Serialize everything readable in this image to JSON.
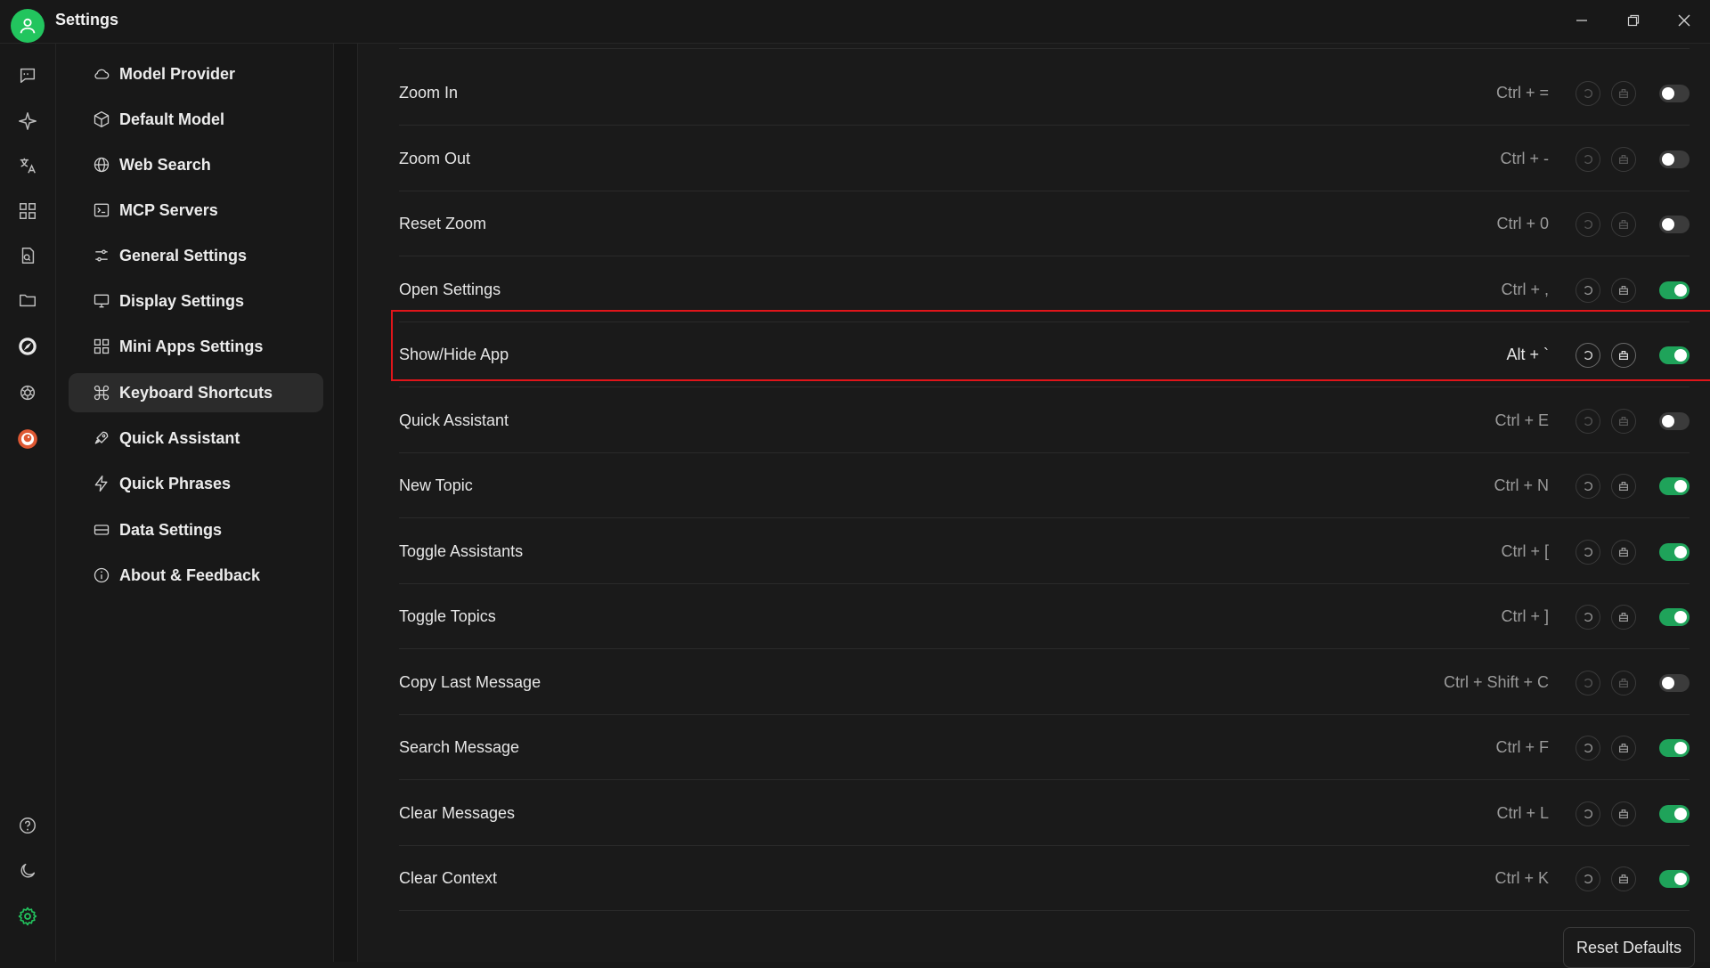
{
  "window": {
    "title": "Settings"
  },
  "nav": {
    "items": [
      {
        "label": "Model Provider",
        "icon": "cloud-icon"
      },
      {
        "label": "Default Model",
        "icon": "cube-icon"
      },
      {
        "label": "Web Search",
        "icon": "globe-icon"
      },
      {
        "label": "MCP Servers",
        "icon": "terminal-icon"
      },
      {
        "label": "General Settings",
        "icon": "sliders-icon"
      },
      {
        "label": "Display Settings",
        "icon": "monitor-icon"
      },
      {
        "label": "Mini Apps Settings",
        "icon": "grid-icon"
      },
      {
        "label": "Keyboard Shortcuts",
        "icon": "command-icon",
        "active": true
      },
      {
        "label": "Quick Assistant",
        "icon": "rocket-icon"
      },
      {
        "label": "Quick Phrases",
        "icon": "zap-icon"
      },
      {
        "label": "Data Settings",
        "icon": "database-icon"
      },
      {
        "label": "About & Feedback",
        "icon": "info-icon"
      }
    ]
  },
  "shortcuts": [
    {
      "label": "Zoom In",
      "keys": "Ctrl + =",
      "enabled": false
    },
    {
      "label": "Zoom Out",
      "keys": "Ctrl + -",
      "enabled": false
    },
    {
      "label": "Reset Zoom",
      "keys": "Ctrl + 0",
      "enabled": false
    },
    {
      "label": "Open Settings",
      "keys": "Ctrl + ,",
      "enabled": true
    },
    {
      "label": "Show/Hide App",
      "keys": "Alt + `",
      "enabled": true,
      "highlighted": true
    },
    {
      "label": "Quick Assistant",
      "keys": "Ctrl + E",
      "enabled": false
    },
    {
      "label": "New Topic",
      "keys": "Ctrl + N",
      "enabled": true
    },
    {
      "label": "Toggle Assistants",
      "keys": "Ctrl + [",
      "enabled": true
    },
    {
      "label": "Toggle Topics",
      "keys": "Ctrl + ]",
      "enabled": true
    },
    {
      "label": "Copy Last Message",
      "keys": "Ctrl + Shift + C",
      "enabled": false
    },
    {
      "label": "Search Message",
      "keys": "Ctrl + F",
      "enabled": true
    },
    {
      "label": "Clear Messages",
      "keys": "Ctrl + L",
      "enabled": true
    },
    {
      "label": "Clear Context",
      "keys": "Ctrl + K",
      "enabled": true
    }
  ],
  "footer": {
    "reset_defaults_label": "Reset Defaults"
  },
  "colors": {
    "accent": "#1fa35a",
    "highlight_border": "#e0151a",
    "background": "#181818"
  }
}
